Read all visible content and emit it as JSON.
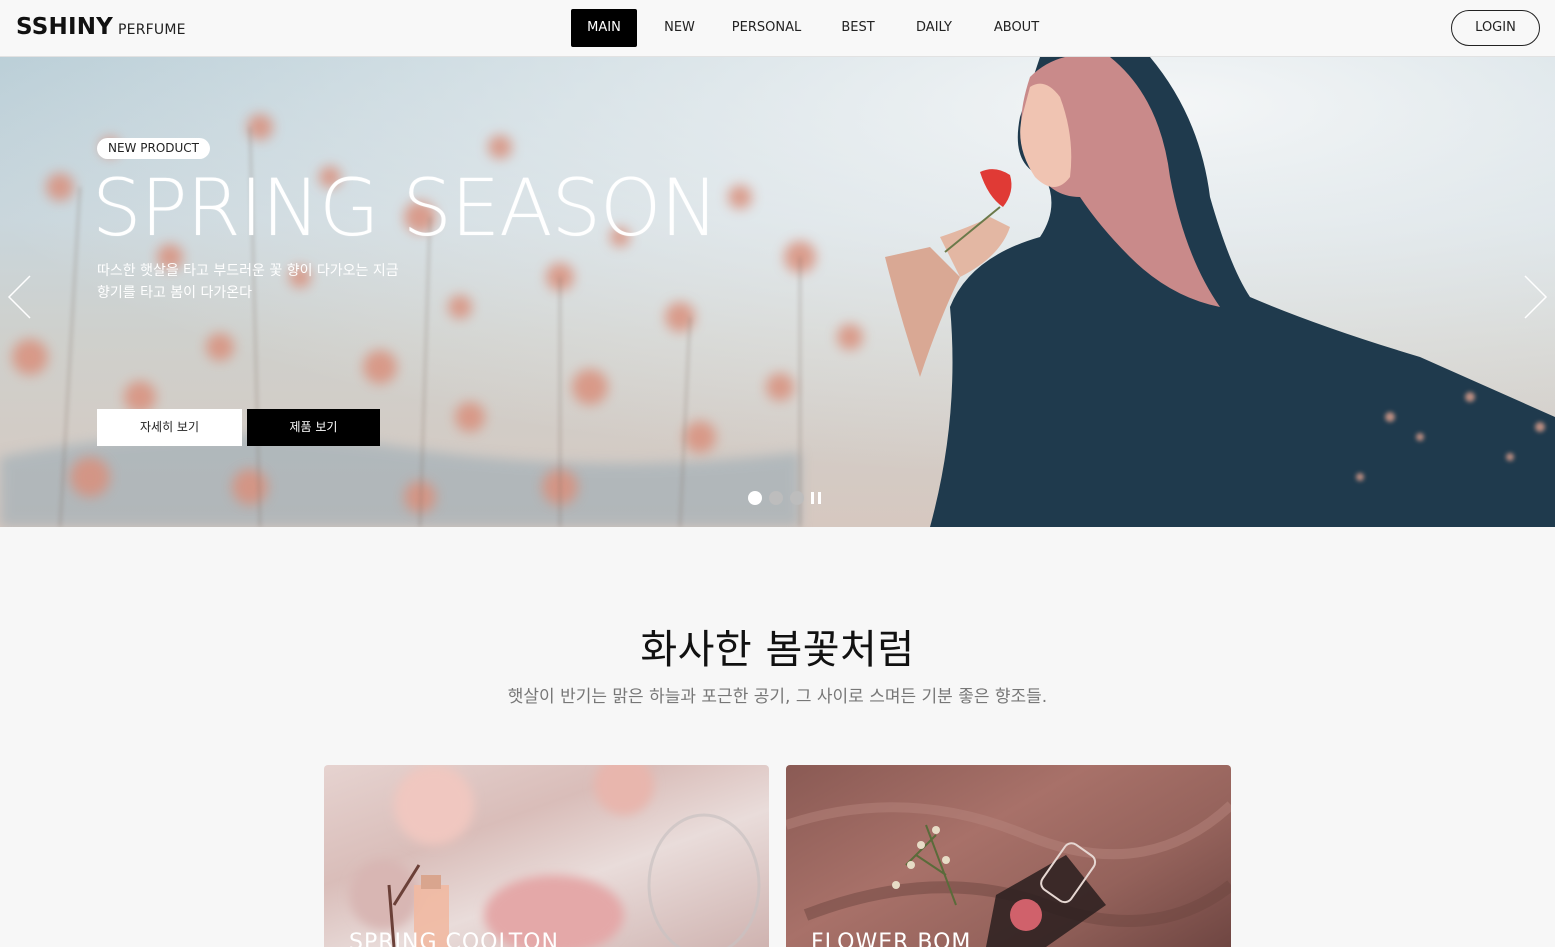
{
  "header": {
    "logo_main": "SSHINY",
    "logo_sub": "PERFUME",
    "nav": [
      {
        "label": "MAIN",
        "active": true
      },
      {
        "label": "NEW",
        "active": false
      },
      {
        "label": "PERSONAL",
        "active": false
      },
      {
        "label": "BEST",
        "active": false
      },
      {
        "label": "DAILY",
        "active": false
      },
      {
        "label": "ABOUT",
        "active": false
      }
    ],
    "login_label": "LOGIN"
  },
  "hero": {
    "badge": "NEW PRODUCT",
    "title": "SPRING SEASON",
    "desc_line1": "따스한 햇살을 타고 부드러운 꽃 향이 다가오는 지금",
    "desc_line2": "향기를 타고 봄이 다가온다",
    "btn_detail": "자세히 보기",
    "btn_product": "제품 보기",
    "slide_count": 3,
    "active_slide": 1
  },
  "section": {
    "title": "화사한 봄꽃처럼",
    "subtitle": "햇살이 반기는 맑은 하늘과 포근한 공기, 그 사이로 스며든 기분 좋은 향조들."
  },
  "cards": [
    {
      "label": "SPRING COOLTON"
    },
    {
      "label": "FLOWER BOM"
    }
  ],
  "colors": {
    "accent": "#000000",
    "background": "#f7f7f7"
  }
}
